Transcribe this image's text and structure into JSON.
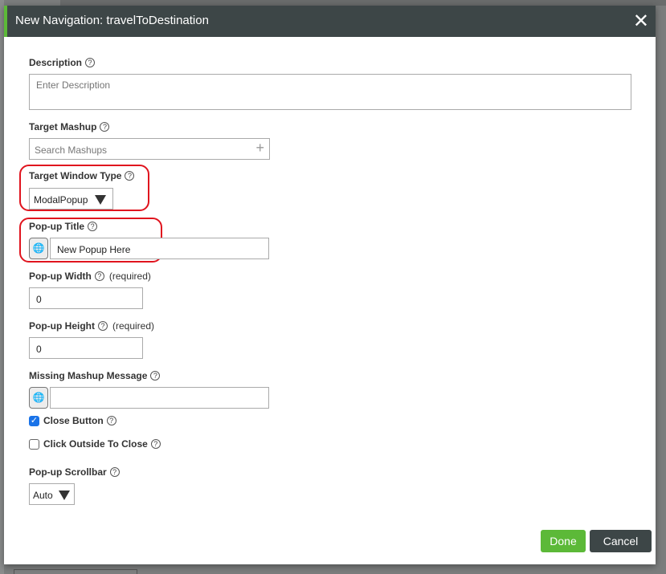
{
  "dialog": {
    "title": "New Navigation: travelToDestination",
    "close_icon": "close-icon"
  },
  "fields": {
    "description": {
      "label": "Description",
      "placeholder": "Enter Description",
      "value": ""
    },
    "target_mashup": {
      "label": "Target Mashup",
      "placeholder": "Search Mashups"
    },
    "target_window_type": {
      "label": "Target Window Type",
      "value": "ModalPopup"
    },
    "popup_title": {
      "label": "Pop-up Title",
      "value": "New Popup Here"
    },
    "popup_width": {
      "label": "Pop-up Width",
      "required": "(required)",
      "value": "0"
    },
    "popup_height": {
      "label": "Pop-up Height",
      "required": "(required)",
      "value": "0"
    },
    "missing_mashup_message": {
      "label": "Missing Mashup Message",
      "value": ""
    },
    "close_button": {
      "label": "Close Button",
      "checked": true
    },
    "click_outside": {
      "label": "Click Outside To Close",
      "checked": false
    },
    "popup_scrollbar": {
      "label": "Pop-up Scrollbar",
      "value": "Auto"
    }
  },
  "help_glyph": "?",
  "buttons": {
    "done": "Done",
    "cancel": "Cancel"
  },
  "colors": {
    "header": "#3d4647",
    "accent": "#5cb938",
    "done": "#5cb938",
    "cancel": "#3d4647",
    "highlight": "#e0141e"
  }
}
